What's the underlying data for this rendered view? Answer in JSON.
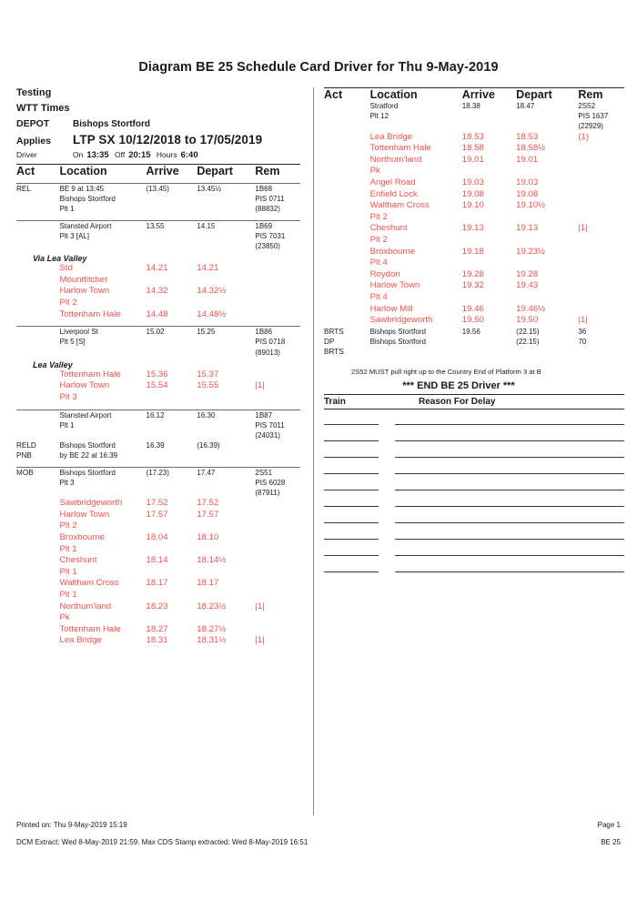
{
  "title": "Diagram BE 25 Schedule Card Driver for Thu 9-May-2019",
  "meta": {
    "testing": "Testing",
    "wtt_times": "WTT Times",
    "depot_label": "DEPOT",
    "depot_value": "Bishops Stortford",
    "applies_label": "Applies",
    "applies_value": "LTP SX 10/12/2018 to 17/05/2019",
    "driver_label": "Driver",
    "on_label": "On",
    "on_value": "13:35",
    "off_label": "Off",
    "off_value": "20:15",
    "hours_label": "Hours",
    "hours_value": "6:40"
  },
  "columns": {
    "act": "Act",
    "location": "Location",
    "arrive": "Arrive",
    "depart": "Depart",
    "rem": "Rem"
  },
  "left_rows": [
    {
      "act": "REL",
      "location": [
        "BE 9 at 13:45",
        "Bishops Stortford",
        "Plt 1"
      ],
      "arrive": "(13.45)",
      "depart": "13.45½",
      "rem": [
        "1B68",
        "PIS 0711",
        "(88832)"
      ],
      "red": false,
      "group_start": true
    },
    {
      "act": "",
      "location": [
        "Stansted Airport",
        "Plt 3 [AL]"
      ],
      "arrive": "13.55",
      "depart": "14.15",
      "rem": [
        "1B69",
        "PIS 7031",
        "(23850)"
      ],
      "red": false,
      "group_start": true
    },
    {
      "via": "Via Lea Valley"
    },
    {
      "act": "",
      "location": [
        "Std",
        "Mountfitchet"
      ],
      "arrive": "14.21",
      "depart": "14.21",
      "rem": [],
      "red": true
    },
    {
      "act": "",
      "location": [
        "Harlow Town",
        "Plt 2"
      ],
      "arrive": "14.32",
      "depart": "14.32½",
      "rem": [],
      "red": true
    },
    {
      "act": "",
      "location": [
        "Tottenham Hale"
      ],
      "arrive": "14.48",
      "depart": "14.48½",
      "rem": [],
      "red": true
    },
    {
      "act": "",
      "location": [
        "Liverpool St",
        "Plt 5 [S]"
      ],
      "arrive": "15.02",
      "depart": "15.25",
      "rem": [
        "1B86",
        "PIS 0718",
        "(89013)"
      ],
      "red": false,
      "group_start": true
    },
    {
      "via": "Lea Valley"
    },
    {
      "act": "",
      "location": [
        "Tottenham Hale"
      ],
      "arrive": "15.36",
      "depart": "15.37",
      "rem": [],
      "red": true
    },
    {
      "act": "",
      "location": [
        "Harlow Town",
        "Plt 3"
      ],
      "arrive": "15.54",
      "depart": "15.55",
      "rem": [
        "|1|"
      ],
      "red": true
    },
    {
      "act": "",
      "location": [
        "Stansted Airport",
        "Plt 1"
      ],
      "arrive": "16.12",
      "depart": "16.30",
      "rem": [
        "1B87",
        "PIS 7011",
        "(24031)"
      ],
      "red": false,
      "group_start": true
    },
    {
      "act": "RELD\nPNB",
      "location": [
        "Bishops Stortford",
        "by BE 22 at 16:39"
      ],
      "arrive": "16.39",
      "depart": "(16.39)",
      "rem": [],
      "red": false
    },
    {
      "act": "MOB",
      "location": [
        "Bishops Stortford",
        "Plt 3"
      ],
      "arrive": "(17.23)",
      "depart": "17.47",
      "rem": [
        "2S51",
        "PIS 6028",
        "(87911)"
      ],
      "red": false,
      "group_start": true
    },
    {
      "act": "",
      "location": [
        "Sawbridgeworth"
      ],
      "arrive": "17.52",
      "depart": "17.52",
      "rem": [],
      "red": true
    },
    {
      "act": "",
      "location": [
        "Harlow Town",
        "Plt 2"
      ],
      "arrive": "17.57",
      "depart": "17.57",
      "rem": [],
      "red": true
    },
    {
      "act": "",
      "location": [
        "Broxbourne",
        "Plt 1"
      ],
      "arrive": "18.04",
      "depart": "18.10",
      "rem": [],
      "red": true
    },
    {
      "act": "",
      "location": [
        "Cheshunt",
        "Plt 1"
      ],
      "arrive": "18.14",
      "depart": "18.14½",
      "rem": [],
      "red": true
    },
    {
      "act": "",
      "location": [
        "Waltham Cross",
        "Plt 1"
      ],
      "arrive": "18.17",
      "depart": "18.17",
      "rem": [],
      "red": true
    },
    {
      "act": "",
      "location": [
        "Northum'land",
        "Pk"
      ],
      "arrive": "18.23",
      "depart": "18.23½",
      "rem": [
        "|1|"
      ],
      "red": true
    },
    {
      "act": "",
      "location": [
        "Tottenham Hale"
      ],
      "arrive": "18.27",
      "depart": "18.27½",
      "rem": [],
      "red": true
    },
    {
      "act": "",
      "location": [
        "Lea Bridge"
      ],
      "arrive": "18.31",
      "depart": "18.31½",
      "rem": [
        "|1|"
      ],
      "red": true
    }
  ],
  "right_rows": [
    {
      "act": "",
      "location": [
        "Stratford",
        "Plt 12"
      ],
      "arrive": "18.38",
      "depart": "18.47",
      "rem": [
        "2S52",
        "PIS 1637",
        "(22929)"
      ],
      "red": false
    },
    {
      "act": "",
      "location": [
        "Lea Bridge"
      ],
      "arrive": "18.53",
      "depart": "18.53",
      "rem": [
        "(1)"
      ],
      "red": true
    },
    {
      "act": "",
      "location": [
        "Tottenham Hale"
      ],
      "arrive": "18.58",
      "depart": "18.58½",
      "rem": [],
      "red": true
    },
    {
      "act": "",
      "location": [
        "Northum'land",
        "Pk"
      ],
      "arrive": "19.01",
      "depart": "19.01",
      "rem": [],
      "red": true
    },
    {
      "act": "",
      "location": [
        "Angel Road"
      ],
      "arrive": "19.03",
      "depart": "19.03",
      "rem": [],
      "red": true
    },
    {
      "act": "",
      "location": [
        "Enfield Lock"
      ],
      "arrive": "19.08",
      "depart": "19.08",
      "rem": [],
      "red": true
    },
    {
      "act": "",
      "location": [
        "Waltham Cross",
        "Plt 2"
      ],
      "arrive": "19.10",
      "depart": "19.10½",
      "rem": [],
      "red": true
    },
    {
      "act": "",
      "location": [
        "Cheshunt",
        "Plt 2"
      ],
      "arrive": "19.13",
      "depart": "19.13",
      "rem": [
        "|1|"
      ],
      "red": true
    },
    {
      "act": "",
      "location": [
        "Broxbourne",
        "Plt 4"
      ],
      "arrive": "19.18",
      "depart": "19.23½",
      "rem": [],
      "red": true
    },
    {
      "act": "",
      "location": [
        "Roydon"
      ],
      "arrive": "19.28",
      "depart": "19.28",
      "rem": [],
      "red": true
    },
    {
      "act": "",
      "location": [
        "Harlow Town",
        "Plt 4"
      ],
      "arrive": "19.32",
      "depart": "19.43",
      "rem": [],
      "red": true
    },
    {
      "act": "",
      "location": [
        "Harlow Mill"
      ],
      "arrive": "19.46",
      "depart": "19.46½",
      "rem": [],
      "red": true
    },
    {
      "act": "",
      "location": [
        "Sawbridgeworth"
      ],
      "arrive": "19.50",
      "depart": "19.50",
      "rem": [
        "|1|"
      ],
      "red": true
    },
    {
      "act": "BRTS",
      "location": [
        "Bishops Stortford"
      ],
      "arrive": "19.56",
      "depart": "(22.15)",
      "rem": [
        "36"
      ],
      "red": false
    },
    {
      "act": "DP\nBRTS",
      "location": [
        "Bishops Stortford"
      ],
      "arrive": "",
      "depart": "(22.15)",
      "rem": [
        "70"
      ],
      "red": false
    }
  ],
  "note": "2S52 MUST pull right up to the Country End of Platform 3 at B",
  "end_marker": "*** END BE 25 Driver ***",
  "delay_table": {
    "train_header": "Train",
    "reason_header": "Reason For Delay",
    "row_count": 10
  },
  "footer": {
    "printed_on": "Printed on: Thu 9-May-2019 15:19",
    "page": "Page 1",
    "dcm_extract": "DCM Extract: Wed 8-May-2019 21:59. Max CDS Stamp extracted: Wed 8-May-2019 16:51",
    "diagram_code": "BE 25"
  },
  "colors": {
    "red": "#f0504d",
    "text": "#1b1b1b",
    "rule": "#2a2a2a"
  }
}
